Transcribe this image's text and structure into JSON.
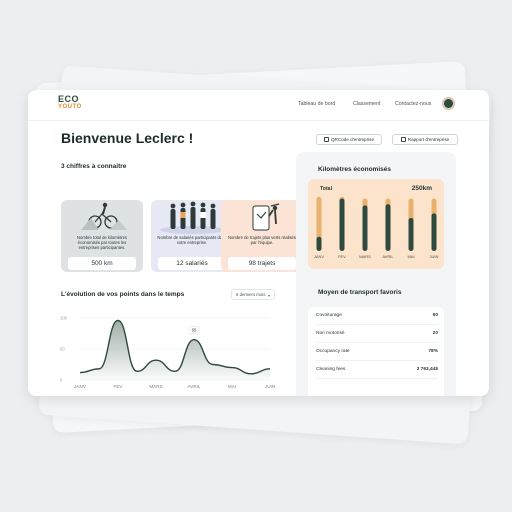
{
  "logo": {
    "line1": "ECO",
    "line2": "YOUTO"
  },
  "nav": {
    "items": [
      "Tableau de bord",
      "Classement",
      "Contactez-nous"
    ]
  },
  "welcome": "Bienvenue Leclerc !",
  "actions": {
    "qr": "QRCode d'entreprise",
    "report": "Rapport d'entreprise"
  },
  "figures": {
    "title": "3 chiffres à connaitre",
    "cards": [
      {
        "text": "Nombre total de kilomètres économisés par toutes les entreprises participantes.",
        "value": "500 km",
        "bg": "#dfe2e5"
      },
      {
        "text": "Nombre de salariés participants dans votre entreprise.",
        "value": "12 salariés",
        "bg": "#e6e8f4"
      },
      {
        "text": "Nombre de trajets plus verts réalisés par l'équipe.",
        "value": "98 trajets",
        "bg": "#fbe3d6"
      }
    ]
  },
  "points": {
    "title": "L'évolution de vos points dans le temps",
    "range": "6 derniers mois",
    "tooltip": "65"
  },
  "chart_data": [
    {
      "type": "area",
      "title": "L'évolution de vos points dans le temps",
      "categories": [
        "JANV",
        "FEV",
        "MARS",
        "AVRIL",
        "MAI",
        "JUIN"
      ],
      "y_ticks": [
        "100",
        "50",
        "0"
      ],
      "ylim": [
        0,
        100
      ],
      "x": [
        0,
        0.5,
        1,
        1.5,
        2,
        2.5,
        3,
        3.5,
        4,
        4.5,
        5
      ],
      "values": [
        12,
        18,
        96,
        14,
        32,
        14,
        65,
        25,
        20,
        10,
        18
      ],
      "grid": true
    },
    {
      "type": "bar",
      "title": "Kilomètres économisés",
      "label": "Total",
      "total": "250km",
      "categories": [
        "JANV",
        "FEV",
        "MARS",
        "AVRIL",
        "MAI",
        "JUIN"
      ],
      "values": [
        25,
        92,
        80,
        82,
        58,
        66
      ],
      "capacity": [
        95,
        95,
        92,
        92,
        92,
        92
      ],
      "ylim": [
        0,
        100
      ]
    }
  ],
  "transport": {
    "title": "Moyen de transport favoris",
    "rows": [
      {
        "name": "Covoiturage",
        "value": "50"
      },
      {
        "name": "Non motorisé",
        "value": "20"
      },
      {
        "name": "Occupancy rate",
        "value": "78%"
      },
      {
        "name": "Cleaning fees",
        "value": "3 763,44$"
      }
    ]
  },
  "colors": {
    "accent": "#2e4a3e",
    "orange": "#e9a35a",
    "peach": "#fbe3cc"
  }
}
